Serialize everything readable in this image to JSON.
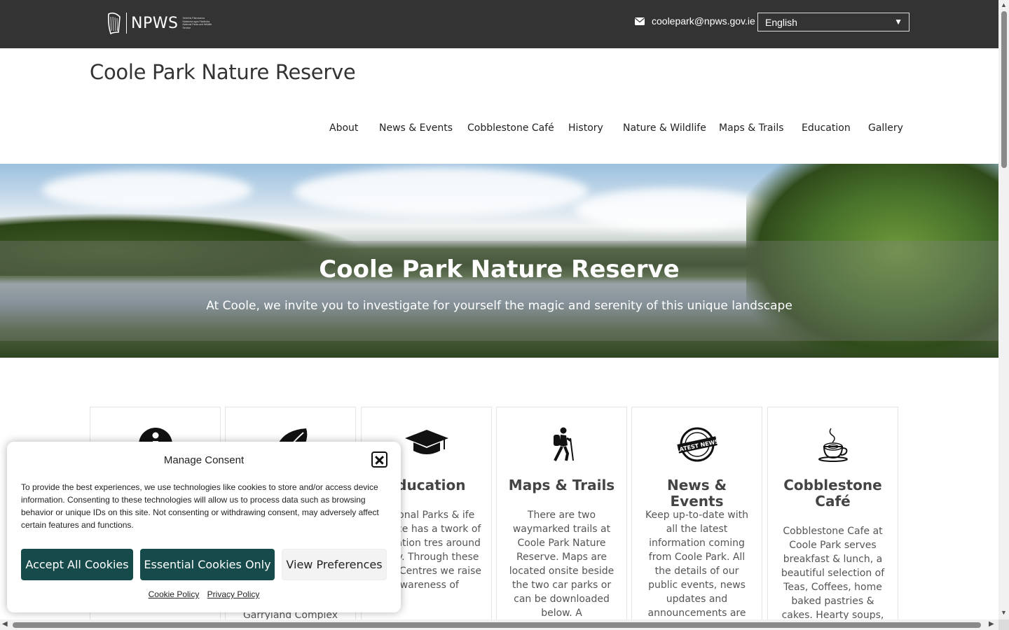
{
  "topbar": {
    "logo_text": "NPWS",
    "logo_tagline": "Seirbhís Páirceanna Náisiúnta agus Fiadhúlra National Parks and Wildlife Service",
    "email": "coolepark@npws.gov.ie",
    "language": "English"
  },
  "header": {
    "site_title": "Coole Park Nature Reserve"
  },
  "nav": {
    "items": [
      {
        "label": "About"
      },
      {
        "label": "News & Events"
      },
      {
        "label": "Cobblestone Café"
      },
      {
        "label": "History"
      },
      {
        "label": "Nature & Wildlife"
      },
      {
        "label": "Maps & Trails"
      },
      {
        "label": "Education"
      },
      {
        "label": "Gallery"
      }
    ]
  },
  "hero": {
    "title": "Coole Park Nature Reserve",
    "subtitle": "At Coole, we invite you to investigate for yourself the magic and serenity of this unique landscape"
  },
  "cards": [
    {
      "title": "",
      "icon": "info-icon",
      "text": ""
    },
    {
      "title": "",
      "icon": "leaf-icon",
      "text": "Garryland Complex"
    },
    {
      "title": "Education",
      "icon": "graduation-cap-icon",
      "text": "National Parks & ife Service has a twork of Education tres around the ry. Through these ation Centres we raise awareness of"
    },
    {
      "title": "Maps & Trails",
      "icon": "hiker-icon",
      "text": "There are two waymarked trails at Coole Park Nature Reserve. Maps are located onsite beside the two car parks or can be downloaded below. A"
    },
    {
      "title": "News & Events",
      "icon": "latest-news-stamp-icon",
      "text": "Keep up-to-date with all the latest information coming from Coole Park. All the details of our public events, news updates and announcements are here."
    },
    {
      "title": "Cobblestone Café",
      "icon": "coffee-cup-icon",
      "text": "Cobblestone Cafe at Coole Park serves breakfast & lunch, a beautiful selection of Teas, Coffees,  home baked pastries & cakes. Hearty soups, Quiches,"
    }
  ],
  "consent": {
    "title": "Manage Consent",
    "text": "To provide the best experiences, we use technologies like cookies to store and/or access device information. Consenting to these technologies will allow us to process data such as browsing behavior or unique IDs on this site. Not consenting or withdrawing consent, may adversely affect certain features and functions.",
    "accept_label": "Accept All Cookies",
    "essential_label": "Essential Cookies Only",
    "preferences_label": "View Preferences",
    "cookie_policy": "Cookie Policy",
    "privacy_policy": "Privacy Policy"
  },
  "colors": {
    "topbar": "#333333",
    "consent_button": "#174b4b"
  }
}
